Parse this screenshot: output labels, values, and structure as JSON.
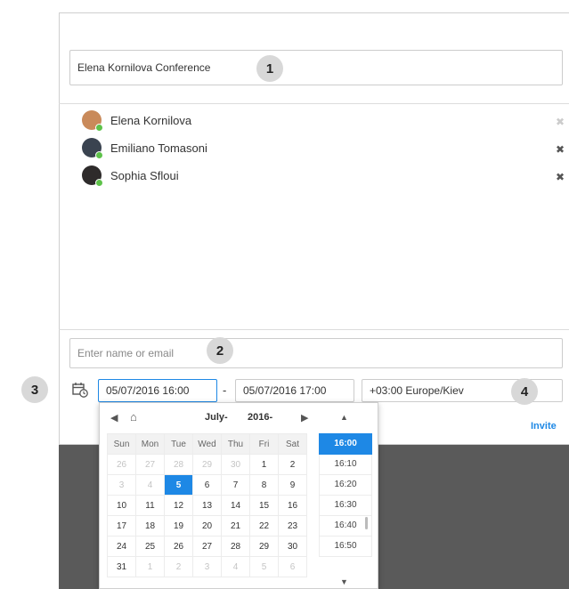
{
  "conference": {
    "title_value": "Elena Kornilova Conference"
  },
  "participants": [
    {
      "name": "Elena Kornilova",
      "avatar_color": "#c98a5a",
      "remove": "✖"
    },
    {
      "name": "Emiliano Tomasoni",
      "avatar_color": "#3a4350",
      "remove": "✖"
    },
    {
      "name": "Sophia Sfloui",
      "avatar_color": "#2e2b2b",
      "remove": "✖"
    }
  ],
  "invite": {
    "placeholder": "Enter name or email",
    "button_label": "Invite"
  },
  "schedule": {
    "start": "05/07/2016 16:00",
    "dash": "-",
    "end": "05/07/2016 17:00",
    "timezone": "+03:00 Europe/Kiev"
  },
  "badges": {
    "b1": "1",
    "b2": "2",
    "b3": "3",
    "b4": "4"
  },
  "calendar": {
    "month": "July",
    "year": "2016",
    "weekdays": [
      "Sun",
      "Mon",
      "Tue",
      "Wed",
      "Thu",
      "Fri",
      "Sat"
    ],
    "weeks": [
      [
        "26",
        "27",
        "28",
        "29",
        "30",
        "1",
        "2"
      ],
      [
        "3",
        "4",
        "5",
        "6",
        "7",
        "8",
        "9"
      ],
      [
        "10",
        "11",
        "12",
        "13",
        "14",
        "15",
        "16"
      ],
      [
        "17",
        "18",
        "19",
        "20",
        "21",
        "22",
        "23"
      ],
      [
        "24",
        "25",
        "26",
        "27",
        "28",
        "29",
        "30"
      ],
      [
        "31",
        "1",
        "2",
        "3",
        "4",
        "5",
        "6"
      ]
    ],
    "selected_day": "5",
    "times": [
      "16:00",
      "16:10",
      "16:20",
      "16:30",
      "16:40",
      "16:50"
    ],
    "selected_time": "16:00"
  },
  "colors": {
    "accent": "#1e88e5",
    "online": "#5ec24a"
  }
}
